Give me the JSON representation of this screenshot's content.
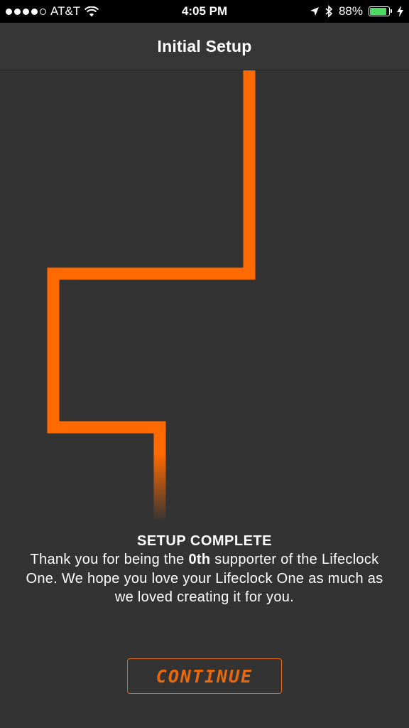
{
  "status_bar": {
    "carrier": "AT&T",
    "time": "4:05 PM",
    "battery_percent": "88%",
    "battery_level": 0.88,
    "signal_bars_filled": 4,
    "signal_bars_total": 5,
    "icons": [
      "wifi-icon",
      "location-arrow-icon",
      "bluetooth-icon",
      "battery-icon",
      "charging-bolt-icon"
    ]
  },
  "nav": {
    "title": "Initial Setup"
  },
  "message": {
    "title": "SETUP COMPLETE",
    "body_before": "Thank you  for being the ",
    "body_bold": "0th",
    "body_after": " supporter of the Lifeclock One. We hope you love your Lifeclock One as much as we loved creating it for you."
  },
  "button": {
    "continue_label": "CONTINUE"
  },
  "colors": {
    "accent": "#ff6a00",
    "background": "#333333",
    "nav_background": "#363636",
    "status_bar": "#000000",
    "battery_green": "#4cd964"
  }
}
